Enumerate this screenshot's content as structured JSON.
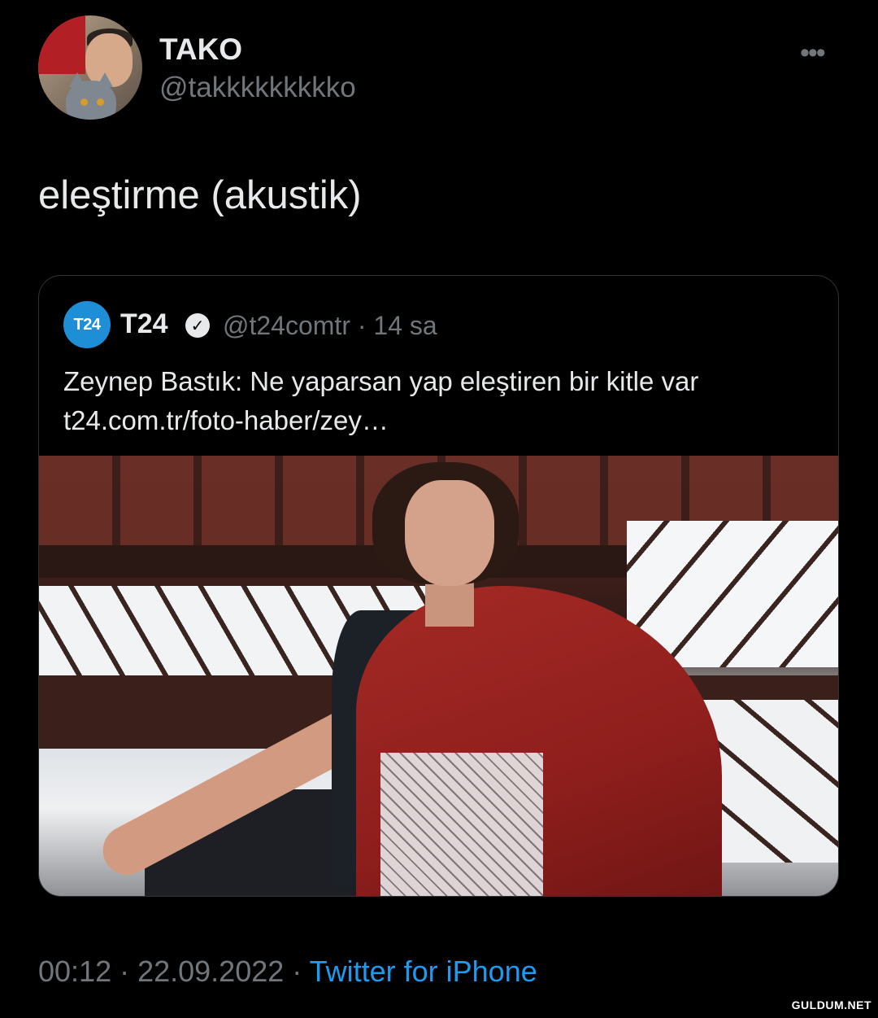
{
  "tweet": {
    "author": {
      "display_name": "TAKO",
      "handle": "@takkkkkkkkko"
    },
    "text": "eleştirme (akustik)",
    "more_icon": "more-horizontal-icon",
    "quoted": {
      "avatar_text": "T24",
      "display_name": "T24",
      "verified_icon": "verified-badge-icon",
      "meta": "@t24comtr · 14 sa",
      "text": "Zeynep Bastık: Ne yaparsan yap eleştiren bir kitle var",
      "link": "t24.com.tr/foto-haber/zey…"
    },
    "timestamp": "00:12 · 22.09.2022 · ",
    "source": "Twitter for iPhone"
  },
  "watermark": "GULDUM.NET",
  "colors": {
    "background": "#000000",
    "text": "#e7e9ea",
    "secondary": "#71767b",
    "link": "#1d9bf0",
    "t24_blue": "#1e8ed6"
  }
}
